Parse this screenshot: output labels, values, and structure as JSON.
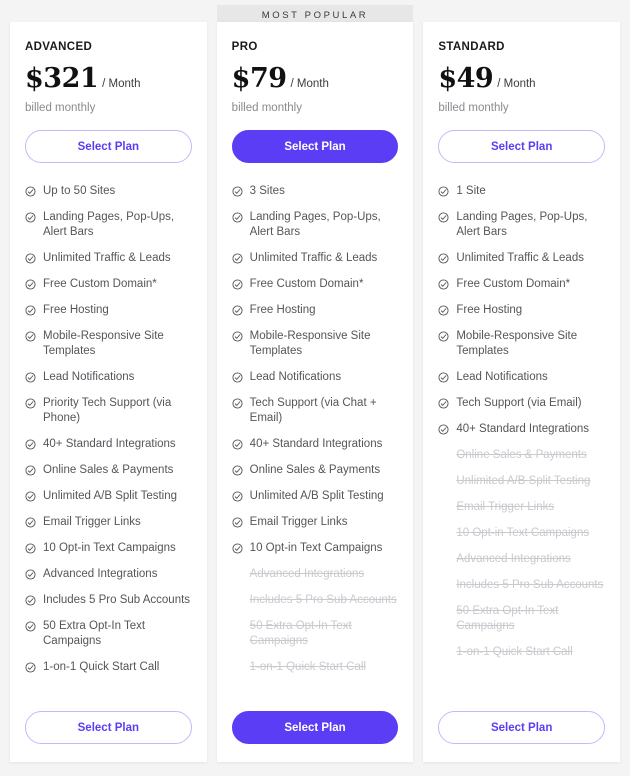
{
  "theme": {
    "accent": "#5b3df5",
    "accent_border": "#c3b9fb",
    "page_background": "#f4f4f5",
    "card_background": "#ffffff",
    "banner_background": "#e7e7e8",
    "text_primary": "#1a1a1c",
    "text_muted": "#8a8a90",
    "text_disabled": "#c9c9cf"
  },
  "badge": {
    "label": "MOST POPULAR"
  },
  "icons": {
    "check": "circle-check-icon"
  },
  "plans": [
    {
      "id": "advanced",
      "name": "ADVANCED",
      "price": "$321",
      "period": "/ Month",
      "billing_note": "billed monthly",
      "featured": false,
      "top_button_label": "Select Plan",
      "bottom_button_label": "Select Plan",
      "features": [
        {
          "label": "Up to 50 Sites",
          "included": true
        },
        {
          "label": "Landing Pages, Pop-Ups, Alert Bars",
          "included": true
        },
        {
          "label": "Unlimited Traffic & Leads",
          "included": true
        },
        {
          "label": "Free Custom Domain*",
          "included": true
        },
        {
          "label": "Free Hosting",
          "included": true
        },
        {
          "label": "Mobile-Responsive Site Templates",
          "included": true
        },
        {
          "label": "Lead Notifications",
          "included": true
        },
        {
          "label": "Priority Tech Support (via Phone)",
          "included": true
        },
        {
          "label": "40+ Standard Integrations",
          "included": true
        },
        {
          "label": "Online Sales & Payments",
          "included": true
        },
        {
          "label": "Unlimited A/B Split Testing",
          "included": true
        },
        {
          "label": "Email Trigger Links",
          "included": true
        },
        {
          "label": "10 Opt-in Text Campaigns",
          "included": true
        },
        {
          "label": "Advanced Integrations",
          "included": true
        },
        {
          "label": "Includes 5 Pro Sub Accounts",
          "included": true
        },
        {
          "label": "50 Extra Opt-In Text Campaigns",
          "included": true
        },
        {
          "label": "1-on-1 Quick Start Call",
          "included": true
        }
      ]
    },
    {
      "id": "pro",
      "name": "PRO",
      "price": "$79",
      "period": "/ Month",
      "billing_note": "billed monthly",
      "featured": true,
      "top_button_label": "Select Plan",
      "bottom_button_label": "Select Plan",
      "features": [
        {
          "label": "3 Sites",
          "included": true
        },
        {
          "label": "Landing Pages, Pop-Ups, Alert Bars",
          "included": true
        },
        {
          "label": "Unlimited Traffic & Leads",
          "included": true
        },
        {
          "label": "Free Custom Domain*",
          "included": true
        },
        {
          "label": "Free Hosting",
          "included": true
        },
        {
          "label": "Mobile-Responsive Site Templates",
          "included": true
        },
        {
          "label": "Lead Notifications",
          "included": true
        },
        {
          "label": "Tech Support (via Chat + Email)",
          "included": true
        },
        {
          "label": "40+ Standard Integrations",
          "included": true
        },
        {
          "label": "Online Sales & Payments",
          "included": true
        },
        {
          "label": "Unlimited A/B Split Testing",
          "included": true
        },
        {
          "label": "Email Trigger Links",
          "included": true
        },
        {
          "label": "10 Opt-in Text Campaigns",
          "included": true
        },
        {
          "label": "Advanced Integrations",
          "included": false
        },
        {
          "label": "Includes 5 Pro Sub Accounts",
          "included": false
        },
        {
          "label": "50 Extra Opt-In Text Campaigns",
          "included": false
        },
        {
          "label": "1-on-1 Quick Start Call",
          "included": false
        }
      ]
    },
    {
      "id": "standard",
      "name": "STANDARD",
      "price": "$49",
      "period": "/ Month",
      "billing_note": "billed monthly",
      "featured": false,
      "top_button_label": "Select Plan",
      "bottom_button_label": "Select Plan",
      "features": [
        {
          "label": "1 Site",
          "included": true
        },
        {
          "label": "Landing Pages, Pop-Ups, Alert Bars",
          "included": true
        },
        {
          "label": "Unlimited Traffic & Leads",
          "included": true
        },
        {
          "label": "Free Custom Domain*",
          "included": true
        },
        {
          "label": "Free Hosting",
          "included": true
        },
        {
          "label": "Mobile-Responsive Site Templates",
          "included": true
        },
        {
          "label": "Lead Notifications",
          "included": true
        },
        {
          "label": "Tech Support (via Email)",
          "included": true
        },
        {
          "label": "40+ Standard Integrations",
          "included": true
        },
        {
          "label": "Online Sales & Payments",
          "included": false
        },
        {
          "label": "Unlimited A/B Split Testing",
          "included": false
        },
        {
          "label": "Email Trigger Links",
          "included": false
        },
        {
          "label": "10 Opt-in Text Campaigns",
          "included": false
        },
        {
          "label": "Advanced Integrations",
          "included": false
        },
        {
          "label": "Includes 5 Pro Sub Accounts",
          "included": false
        },
        {
          "label": "50 Extra Opt-In Text Campaigns",
          "included": false
        },
        {
          "label": "1-on-1 Quick Start Call",
          "included": false
        }
      ]
    }
  ]
}
